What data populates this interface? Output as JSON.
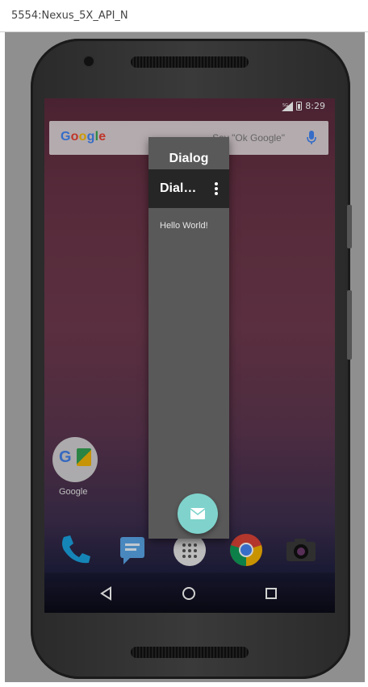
{
  "window": {
    "title": "5554:Nexus_5X_API_N"
  },
  "status_bar": {
    "time": "8:29",
    "network": "5G"
  },
  "search": {
    "logo": "Google",
    "hint": "Say \"Ok Google\""
  },
  "dialog": {
    "title": "Dialog",
    "toolbar_title": "Dial…",
    "body_text": "Hello World!"
  },
  "home": {
    "app_label": "Google"
  },
  "dock": [
    "phone-icon",
    "messages-icon",
    "apps-icon",
    "chrome-icon",
    "camera-icon"
  ],
  "nav": [
    "back-icon",
    "home-icon",
    "recents-icon"
  ],
  "colors": {
    "fab": "#7fd3cc",
    "toolbar": "#262626",
    "dialog": "#595959"
  }
}
